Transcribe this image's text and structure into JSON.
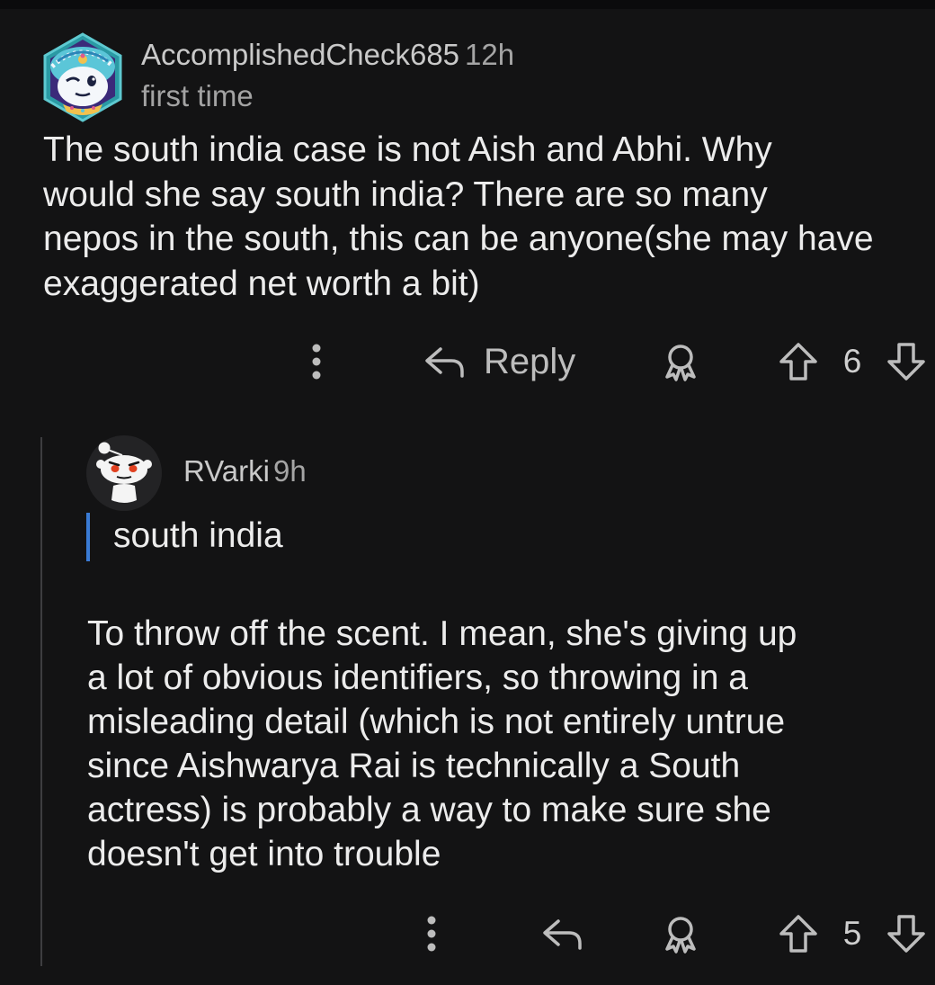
{
  "comments": [
    {
      "username": "AccomplishedCheck685",
      "time": "12h",
      "flair": "first time",
      "avatar_icon": "snoo-turban-avatar-icon",
      "body_lines": [
        "The south india case is not Aish and Abhi. Why",
        "would she say south india? There are so many",
        "nepos in the south, this can be anyone(she may have",
        "exaggerated net worth a bit)"
      ],
      "actions": {
        "more_icon": "more-vertical-icon",
        "reply_icon": "reply-arrow-icon",
        "reply_label": "Reply",
        "award_icon": "award-icon",
        "upvote_icon": "upvote-arrow-icon",
        "score": "6",
        "downvote_icon": "downvote-arrow-icon"
      }
    },
    {
      "username": "RVarki",
      "time": "9h",
      "avatar_icon": "snoo-default-avatar-icon",
      "quote": "south india",
      "body_lines": [
        "To throw off the scent. I mean, she's giving up",
        "a lot of obvious identifiers, so throwing in a",
        "misleading detail (which is not entirely untrue",
        "since Aishwarya Rai is technically a South",
        "actress) is probably a way to make sure she",
        "doesn't get into trouble"
      ],
      "actions": {
        "more_icon": "more-vertical-icon",
        "reply_icon": "reply-arrow-icon",
        "award_icon": "award-icon",
        "upvote_icon": "upvote-arrow-icon",
        "score": "5",
        "downvote_icon": "downvote-arrow-icon"
      }
    }
  ],
  "colors": {
    "background": "#131314",
    "text": "#ececec",
    "muted_text": "#a5a5a5",
    "icon": "#bdbdbd",
    "quote_bar": "#3a7bd5",
    "thread_line": "#3d3d40"
  }
}
